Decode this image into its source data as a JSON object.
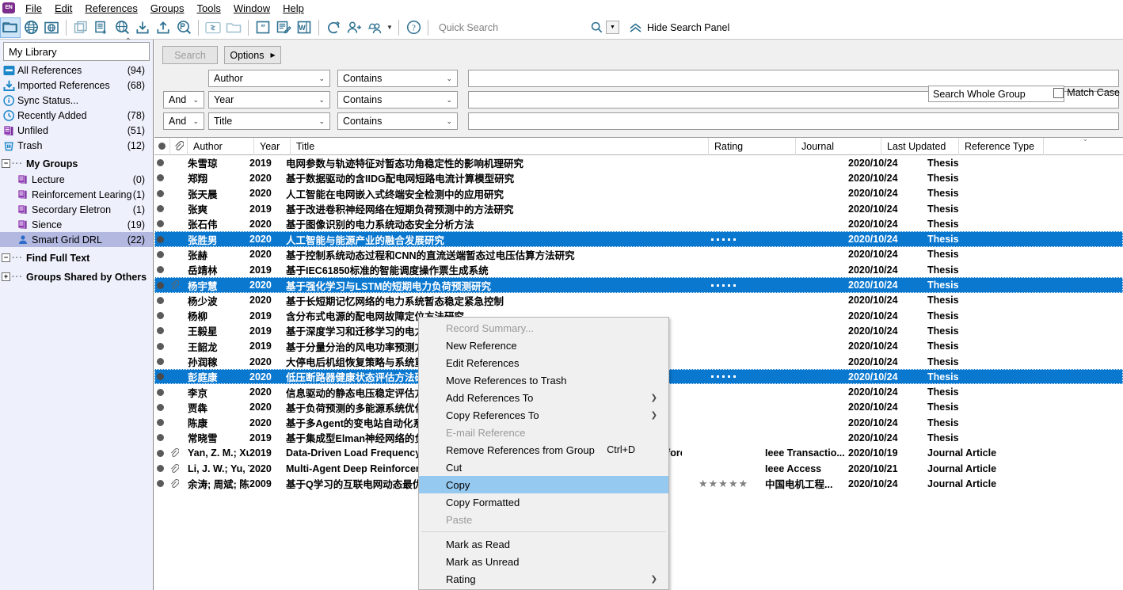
{
  "menubar": {
    "logo": "EN",
    "items": [
      {
        "label": "File",
        "mnemonic": "F"
      },
      {
        "label": "Edit",
        "mnemonic": "E"
      },
      {
        "label": "References",
        "mnemonic": "R"
      },
      {
        "label": "Groups",
        "mnemonic": "G"
      },
      {
        "label": "Tools",
        "mnemonic": "T"
      },
      {
        "label": "Window",
        "mnemonic": "W"
      },
      {
        "label": "Help",
        "mnemonic": "H"
      }
    ]
  },
  "toolbar": {
    "style_value": "Annotated",
    "quick_search_placeholder": "Quick Search",
    "hide_search_panel": "Hide Search Panel",
    "icons": [
      "open-library-icon",
      "online-search-icon",
      "online-search-folder-icon",
      "copy-references-icon",
      "new-reference-icon",
      "online-search-mode-icon",
      "import-icon",
      "export-icon",
      "find-full-text-icon",
      "link-icon",
      "open-file-icon",
      "insert-citation-icon",
      "format-bibliography-icon",
      "word-icon",
      "sync-icon",
      "share-library-icon",
      "activity-feed-icon",
      "help-icon"
    ]
  },
  "sidebar": {
    "library_label": "My Library",
    "items": [
      {
        "label": "All References",
        "count": "(94)",
        "icon": "all-references-icon"
      },
      {
        "label": "Imported References",
        "count": "(68)",
        "icon": "import-icon"
      },
      {
        "label": "Sync Status...",
        "count": "",
        "icon": "sync-status-icon"
      },
      {
        "label": "Recently Added",
        "count": "(78)",
        "icon": "recently-added-icon"
      },
      {
        "label": "Unfiled",
        "count": "(51)",
        "icon": "group-icon"
      },
      {
        "label": "Trash",
        "count": "(12)",
        "icon": "trash-icon"
      }
    ],
    "my_groups_label": "My Groups",
    "groups": [
      {
        "label": "Lecture",
        "count": "(0)",
        "icon": "group-icon",
        "selected": false
      },
      {
        "label": "Reinforcement Learing",
        "count": "(1)",
        "icon": "group-icon",
        "selected": false
      },
      {
        "label": "Secordary Eletron",
        "count": "(1)",
        "icon": "group-icon",
        "selected": false
      },
      {
        "label": "Sience",
        "count": "(19)",
        "icon": "group-icon",
        "selected": false
      },
      {
        "label": "Smart Grid DRL",
        "count": "(22)",
        "icon": "shared-group-icon",
        "selected": true
      }
    ],
    "find_full_text_label": "Find Full Text",
    "groups_shared_label": "Groups Shared by Others"
  },
  "search": {
    "search_button": "Search",
    "options_button": "Options",
    "scope_value": "Search Whole Group",
    "match_case_label": "Match Case",
    "rows": [
      {
        "connector": "",
        "field": "Author",
        "comparator": "Contains",
        "value": ""
      },
      {
        "connector": "And",
        "field": "Year",
        "comparator": "Contains",
        "value": ""
      },
      {
        "connector": "And",
        "field": "Title",
        "comparator": "Contains",
        "value": ""
      }
    ]
  },
  "table": {
    "columns": [
      {
        "label": "",
        "name": "read-status"
      },
      {
        "label": "",
        "name": "attachment"
      },
      {
        "label": "Author",
        "name": "author"
      },
      {
        "label": "Year",
        "name": "year"
      },
      {
        "label": "Title",
        "name": "title"
      },
      {
        "label": "Rating",
        "name": "rating"
      },
      {
        "label": "Journal",
        "name": "journal"
      },
      {
        "label": "Last Updated",
        "name": "last-updated"
      },
      {
        "label": "Reference Type",
        "name": "reference-type"
      }
    ],
    "rows": [
      {
        "clip": false,
        "author": "朱雪琼",
        "year": "2019",
        "title": "电网参数与轨迹特征对暂态功角稳定性的影响机理研究",
        "rating": "",
        "journal": "",
        "updated": "2020/10/24",
        "reftype": "Thesis",
        "selected": false
      },
      {
        "clip": false,
        "author": "郑翔",
        "year": "2020",
        "title": "基于数据驱动的含IIDG配电网短路电流计算模型研究",
        "rating": "",
        "journal": "",
        "updated": "2020/10/24",
        "reftype": "Thesis",
        "selected": false
      },
      {
        "clip": false,
        "author": "张天晨",
        "year": "2020",
        "title": "人工智能在电网嵌入式终端安全检测中的应用研究",
        "rating": "",
        "journal": "",
        "updated": "2020/10/24",
        "reftype": "Thesis",
        "selected": false
      },
      {
        "clip": false,
        "author": "张爽",
        "year": "2019",
        "title": "基于改进卷积神经网络在短期负荷预测中的方法研究",
        "rating": "",
        "journal": "",
        "updated": "2020/10/24",
        "reftype": "Thesis",
        "selected": false
      },
      {
        "clip": false,
        "author": "张石伟",
        "year": "2020",
        "title": "基于图像识别的电力系统动态安全分析方法",
        "rating": "",
        "journal": "",
        "updated": "2020/10/24",
        "reftype": "Thesis",
        "selected": false
      },
      {
        "clip": false,
        "author": "张胜男",
        "year": "2020",
        "title": "人工智能与能源产业的融合发展研究",
        "rating": "dots",
        "journal": "",
        "updated": "2020/10/24",
        "reftype": "Thesis",
        "selected": true
      },
      {
        "clip": false,
        "author": "张赫",
        "year": "2020",
        "title": "基于控制系统动态过程和CNN的直流送端暂态过电压估算方法研究",
        "rating": "",
        "journal": "",
        "updated": "2020/10/24",
        "reftype": "Thesis",
        "selected": false
      },
      {
        "clip": false,
        "author": "岳靖林",
        "year": "2019",
        "title": "基于IEC61850标准的智能调度操作票生成系统",
        "rating": "",
        "journal": "",
        "updated": "2020/10/24",
        "reftype": "Thesis",
        "selected": false
      },
      {
        "clip": true,
        "author": "杨宇慧",
        "year": "2020",
        "title": "基于强化学习与LSTM的短期电力负荷预测研究",
        "rating": "dots",
        "journal": "",
        "updated": "2020/10/24",
        "reftype": "Thesis",
        "selected": true
      },
      {
        "clip": false,
        "author": "杨少波",
        "year": "2020",
        "title": "基于长短期记忆网络的电力系统暂态稳定紧急控制",
        "rating": "",
        "journal": "",
        "updated": "2020/10/24",
        "reftype": "Thesis",
        "selected": false
      },
      {
        "clip": false,
        "author": "杨柳",
        "year": "2019",
        "title": "含分布式电源的配电网故障定位方法研究",
        "rating": "",
        "journal": "",
        "updated": "2020/10/24",
        "reftype": "Thesis",
        "selected": false
      },
      {
        "clip": false,
        "author": "王毅星",
        "year": "2019",
        "title": "基于深度学习和迁移学习的电力设备故障诊断",
        "rating": "",
        "journal": "",
        "updated": "2020/10/24",
        "reftype": "Thesis",
        "selected": false
      },
      {
        "clip": false,
        "author": "王韶龙",
        "year": "2019",
        "title": "基于分量分治的风电功率预测方法研究",
        "rating": "",
        "journal": "",
        "updated": "2020/10/24",
        "reftype": "Thesis",
        "selected": false
      },
      {
        "clip": false,
        "author": "孙润稼",
        "year": "2020",
        "title": "大停电后机组恢复策略与系统重构研究",
        "rating": "",
        "journal": "",
        "updated": "2020/10/24",
        "reftype": "Thesis",
        "selected": false
      },
      {
        "clip": false,
        "author": "彭庭康",
        "year": "2020",
        "title": "低压断路器健康状态评估方法研究",
        "rating": "dots",
        "journal": "",
        "updated": "2020/10/24",
        "reftype": "Thesis",
        "selected": true
      },
      {
        "clip": false,
        "author": "李京",
        "year": "2020",
        "title": "信息驱动的静态电压稳定评估方法",
        "rating": "",
        "journal": "",
        "updated": "2020/10/24",
        "reftype": "Thesis",
        "selected": false
      },
      {
        "clip": false,
        "author": "贾犇",
        "year": "2020",
        "title": "基于负荷预测的多能源系统优化调度",
        "rating": "",
        "journal": "",
        "updated": "2020/10/24",
        "reftype": "Thesis",
        "selected": false
      },
      {
        "clip": false,
        "author": "陈康",
        "year": "2020",
        "title": "基于多Agent的变电站自动化系统研究",
        "rating": "",
        "journal": "",
        "updated": "2020/10/24",
        "reftype": "Thesis",
        "selected": false
      },
      {
        "clip": false,
        "author": "常晓雪",
        "year": "2019",
        "title": "基于集成型Elman神经网络的负荷预测",
        "rating": "",
        "journal": "",
        "updated": "2020/10/24",
        "reftype": "Thesis",
        "selected": false
      },
      {
        "clip": true,
        "author": "Yan, Z. M.; Xu, Y.",
        "year": "2019",
        "title": "Data-Driven Load Frequency Control for Stochastic Power Systems: A Deep Reinforce...",
        "rating": "",
        "journal": "Ieee Transactio...",
        "updated": "2020/10/19",
        "reftype": "Journal Article",
        "selected": false
      },
      {
        "clip": true,
        "author": "Li, J. W.; Yu, T.; Zh...",
        "year": "2020",
        "title": "Multi-Agent Deep Reinforcement Learning for Sectional AGC Dispatch",
        "rating": "",
        "journal": "Ieee Access",
        "updated": "2020/10/21",
        "reftype": "Journal Article",
        "selected": false
      },
      {
        "clip": true,
        "author": "余涛; 周斌; 陈家...",
        "year": "2009",
        "title": "基于Q学习的互联电网动态最优CPS控制",
        "rating": "stars5",
        "journal": "中国电机工程...",
        "updated": "2020/10/24",
        "reftype": "Journal Article",
        "selected": false
      }
    ]
  },
  "context_menu": {
    "items": [
      {
        "label": "Record Summary...",
        "disabled": true,
        "submenu": false,
        "accel": "",
        "highlighted": false,
        "separator_after": false
      },
      {
        "label": "New Reference",
        "disabled": false,
        "submenu": false,
        "accel": "",
        "highlighted": false,
        "separator_after": false
      },
      {
        "label": "Edit References",
        "disabled": false,
        "submenu": false,
        "accel": "",
        "highlighted": false,
        "separator_after": false
      },
      {
        "label": "Move References to Trash",
        "disabled": false,
        "submenu": false,
        "accel": "",
        "highlighted": false,
        "separator_after": false
      },
      {
        "label": "Add References To",
        "disabled": false,
        "submenu": true,
        "accel": "",
        "highlighted": false,
        "separator_after": false
      },
      {
        "label": "Copy References To",
        "disabled": false,
        "submenu": true,
        "accel": "",
        "highlighted": false,
        "separator_after": false
      },
      {
        "label": "E-mail Reference",
        "disabled": true,
        "submenu": false,
        "accel": "",
        "highlighted": false,
        "separator_after": false
      },
      {
        "label": "Remove References from Group",
        "disabled": false,
        "submenu": false,
        "accel": "Ctrl+D",
        "highlighted": false,
        "separator_after": false
      },
      {
        "label": "Cut",
        "disabled": false,
        "submenu": false,
        "accel": "",
        "highlighted": false,
        "separator_after": false
      },
      {
        "label": "Copy",
        "disabled": false,
        "submenu": false,
        "accel": "",
        "highlighted": true,
        "separator_after": false
      },
      {
        "label": "Copy Formatted",
        "disabled": false,
        "submenu": false,
        "accel": "",
        "highlighted": false,
        "separator_after": false
      },
      {
        "label": "Paste",
        "disabled": true,
        "submenu": false,
        "accel": "",
        "highlighted": false,
        "separator_after": true
      },
      {
        "label": "Mark as Read",
        "disabled": false,
        "submenu": false,
        "accel": "",
        "highlighted": false,
        "separator_after": false
      },
      {
        "label": "Mark as Unread",
        "disabled": false,
        "submenu": false,
        "accel": "",
        "highlighted": false,
        "separator_after": false
      },
      {
        "label": "Rating",
        "disabled": false,
        "submenu": true,
        "accel": "",
        "highlighted": false,
        "separator_after": true
      }
    ]
  },
  "colors": {
    "selection_blue": "#0b78d0",
    "menu_highlight": "#95c9f0",
    "sidebar_bg": "#eef0fb",
    "sidebar_selected": "#b3b8e0",
    "icon_teal": "#2b6f90"
  }
}
